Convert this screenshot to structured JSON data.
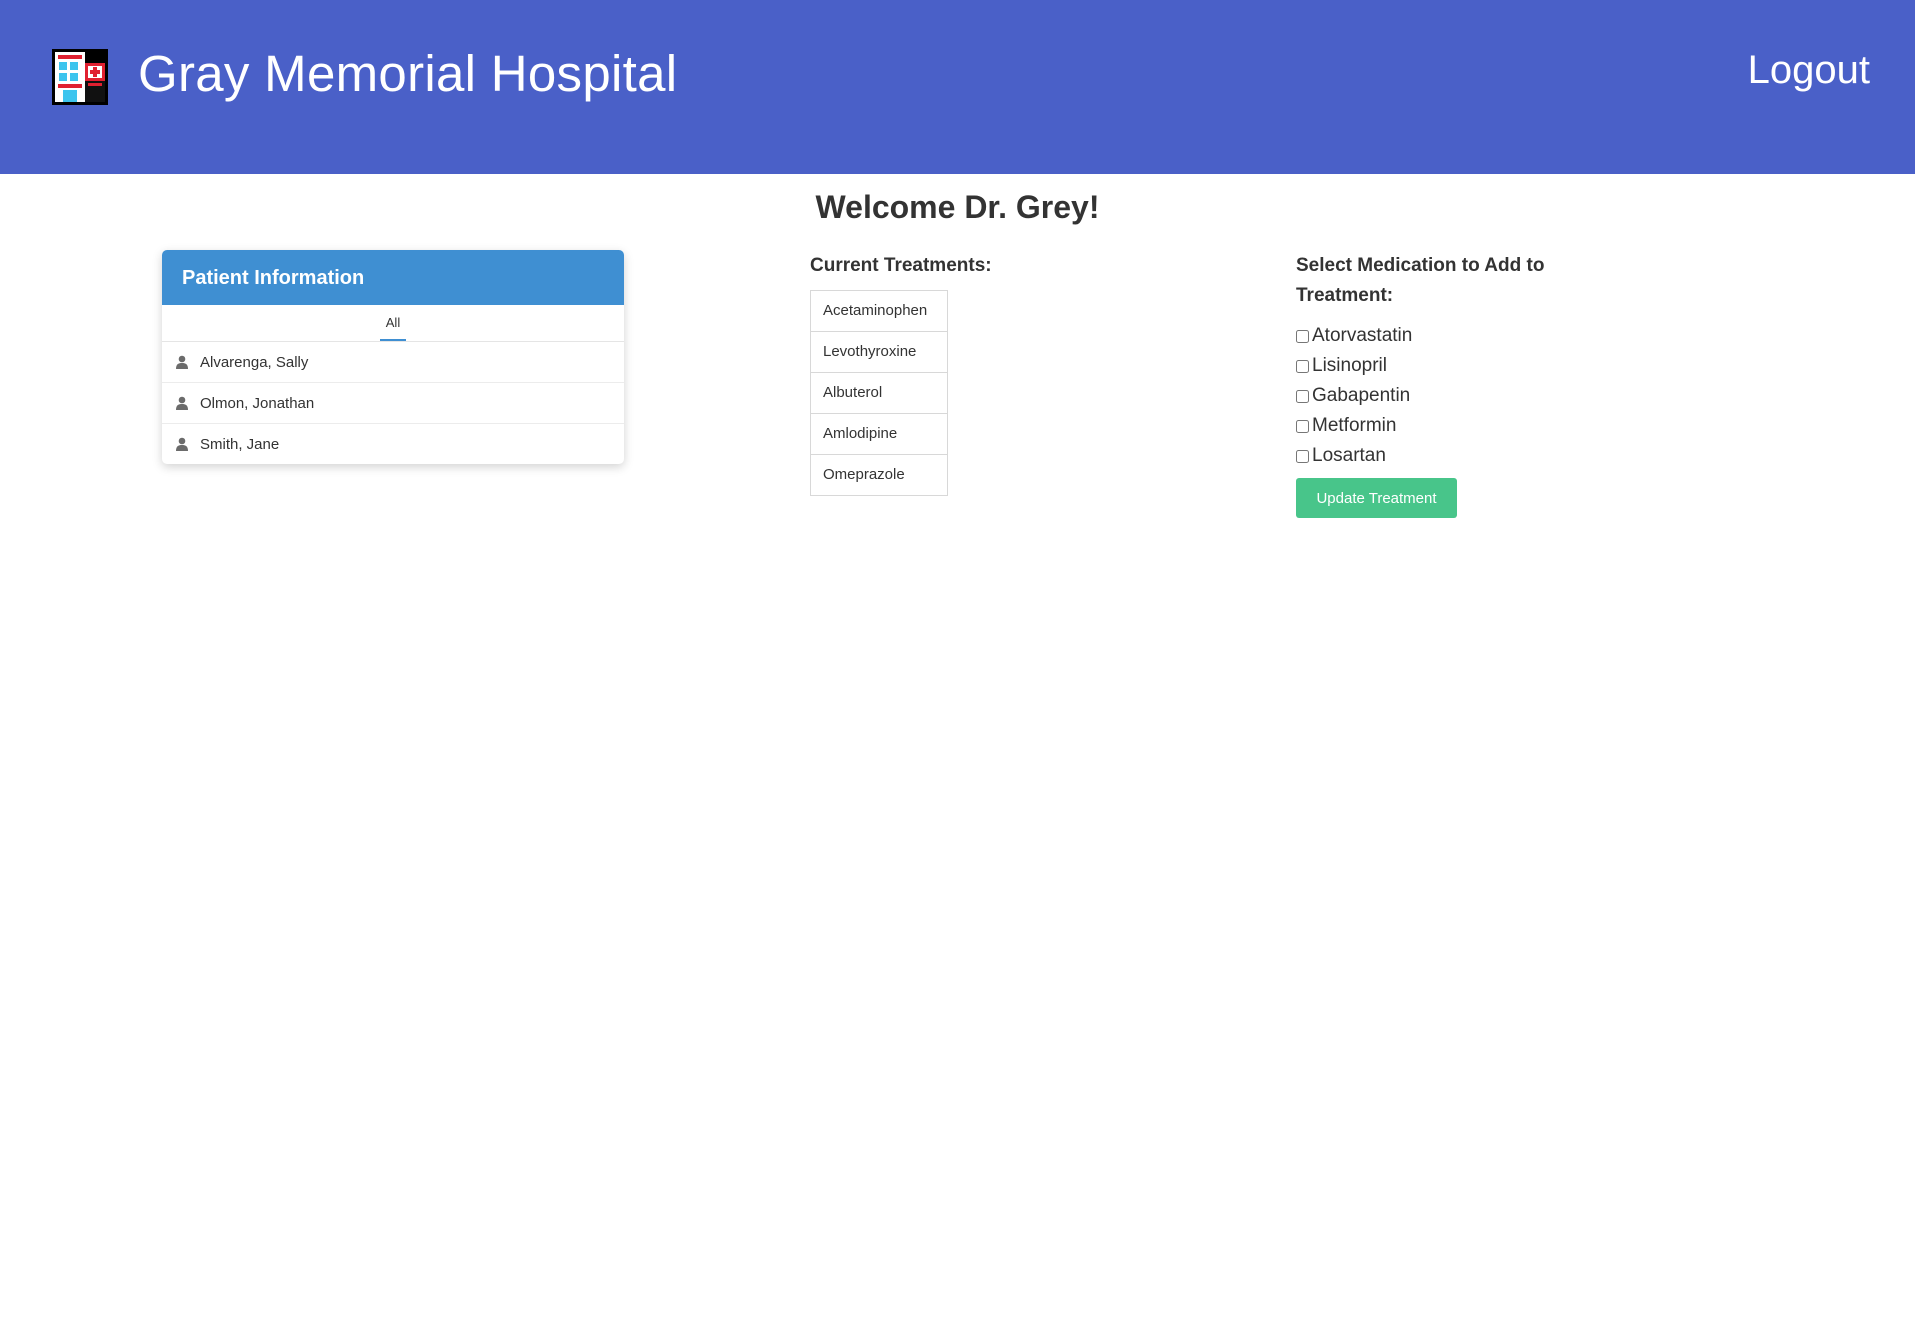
{
  "header": {
    "title": "Gray Memorial Hospital",
    "logout_label": "Logout",
    "logo_icon": "hospital-icon",
    "background": "#4a60c8"
  },
  "welcome": "Welcome Dr. Grey!",
  "patients_panel": {
    "title": "Patient Information",
    "filter_tab": "All",
    "patients": [
      {
        "name": "Alvarenga, Sally",
        "icon": "person-icon"
      },
      {
        "name": "Olmon, Jonathan",
        "icon": "person-icon"
      },
      {
        "name": "Smith, Jane",
        "icon": "person-icon"
      }
    ],
    "header_color": "#3f8fd2"
  },
  "treatments": {
    "title": "Current Treatments:",
    "items": [
      "Acetaminophen",
      "Levothyroxine",
      "Albuterol",
      "Amlodipine",
      "Omeprazole"
    ]
  },
  "medications": {
    "title": "Select Medication to Add to Treatment:",
    "options": [
      {
        "label": "Atorvastatin",
        "checked": false
      },
      {
        "label": "Lisinopril",
        "checked": false
      },
      {
        "label": "Gabapentin",
        "checked": false
      },
      {
        "label": "Metformin",
        "checked": false
      },
      {
        "label": "Losartan",
        "checked": false
      }
    ],
    "update_label": "Update Treatment",
    "button_color": "#48c58a"
  }
}
